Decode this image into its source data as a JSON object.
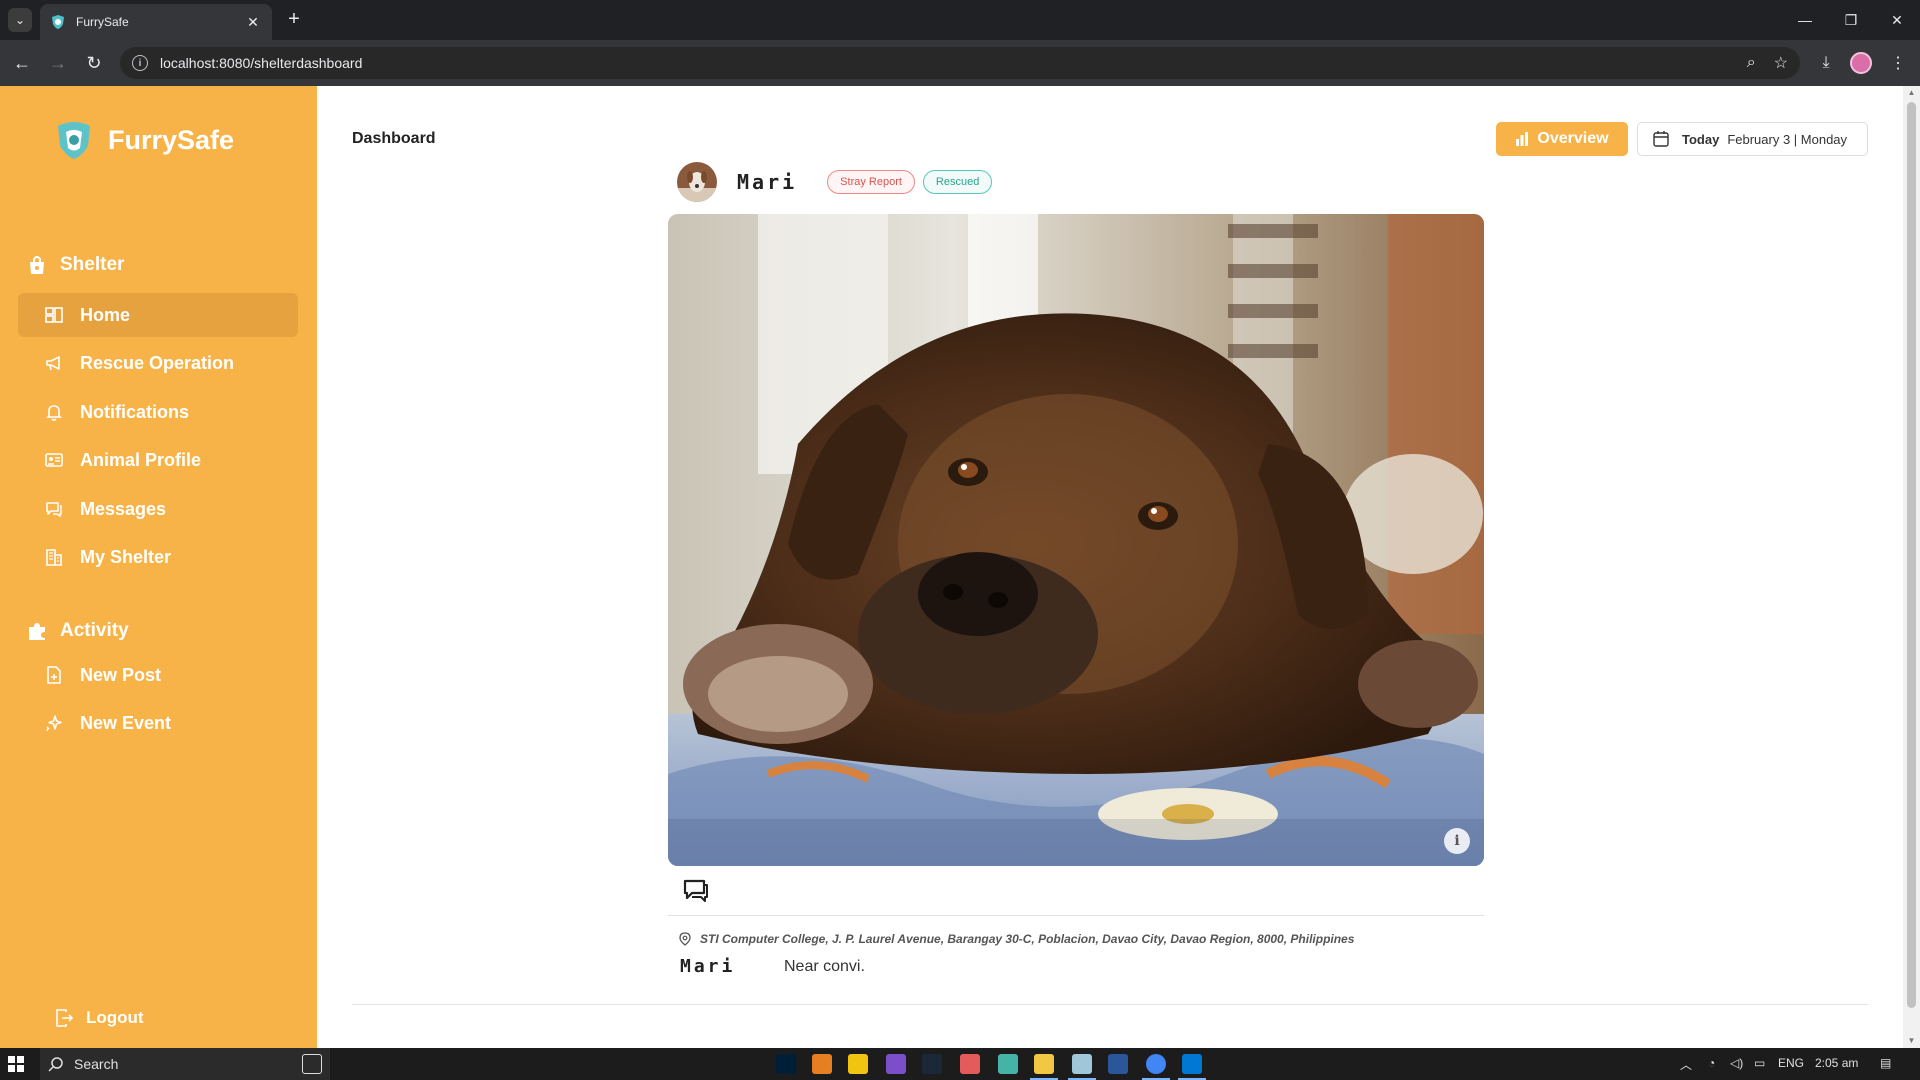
{
  "browser": {
    "tab_title": "FurrySafe",
    "url": "localhost:8080/shelterdashboard"
  },
  "sidebar": {
    "brand": "FurrySafe",
    "sections": {
      "shelter": "Shelter",
      "activity": "Activity"
    },
    "items": [
      {
        "label": "Home",
        "icon": "home-icon",
        "active": true
      },
      {
        "label": "Rescue Operation",
        "icon": "megaphone-icon"
      },
      {
        "label": "Notifications",
        "icon": "bell-icon"
      },
      {
        "label": "Animal Profile",
        "icon": "id-card-icon"
      },
      {
        "label": "Messages",
        "icon": "chat-icon"
      },
      {
        "label": "My Shelter",
        "icon": "building-icon"
      },
      {
        "label": "New Post",
        "icon": "new-file-icon"
      },
      {
        "label": "New Event",
        "icon": "sparkle-icon"
      }
    ],
    "logout": "Logout"
  },
  "header": {
    "title": "Dashboard",
    "overview_label": "Overview",
    "today_label": "Today",
    "date": "February 3 | Monday"
  },
  "post": {
    "author": "Mari",
    "badges": [
      "Stray Report",
      "Rescued"
    ],
    "location": "STI Computer College, J. P. Laurel Avenue, Barangay 30-C, Poblacion, Davao City, Davao Region, 8000, Philippines",
    "caption": "Near convi."
  },
  "taskbar": {
    "search_label": "Search",
    "language": "ENG",
    "time": "2:05 am"
  },
  "colors": {
    "accent": "#f7b347",
    "accent_active": "#e6a23f",
    "stray_badge": "#d9534f",
    "rescued_badge": "#2aa58f"
  }
}
